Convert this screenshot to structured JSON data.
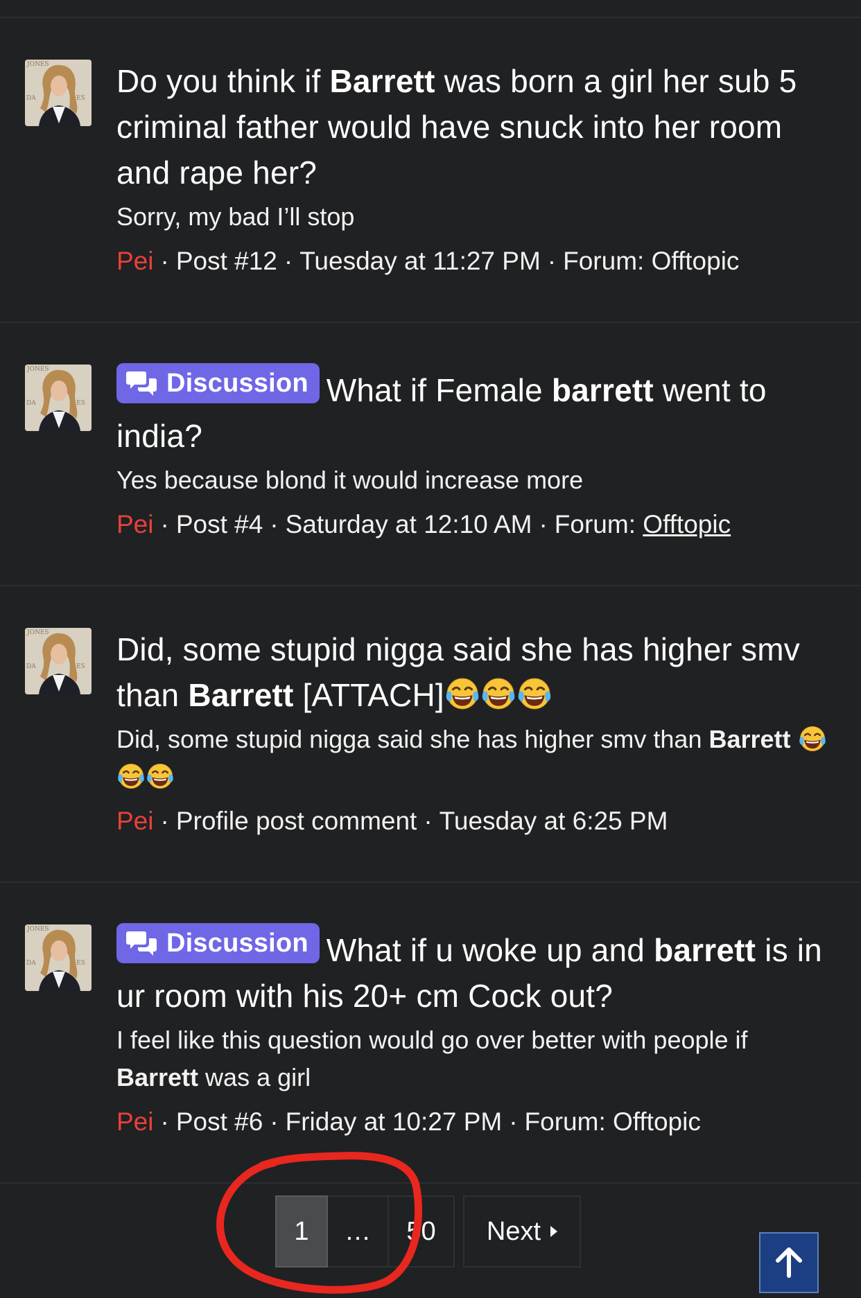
{
  "results": [
    {
      "title_parts": [
        {
          "text": "Do you think if ",
          "bold": false
        },
        {
          "text": "Barrett",
          "bold": true
        },
        {
          "text": " was born a girl her sub 5 criminal father would have snuck into her room and rape her?",
          "bold": false
        }
      ],
      "badge": null,
      "snippet_parts": [
        {
          "text": "Sorry, my bad I’ll stop",
          "bold": false
        }
      ],
      "meta": {
        "user": "Pei",
        "type": "Post #12",
        "time": "Tuesday at 11:27 PM",
        "forum_label": "Forum:",
        "forum": "Offtopic",
        "forum_link": false
      }
    },
    {
      "title_parts": [
        {
          "text": "What if Female ",
          "bold": false
        },
        {
          "text": "barrett",
          "bold": true
        },
        {
          "text": " went to india?",
          "bold": false
        }
      ],
      "badge": "Discussion",
      "snippet_parts": [
        {
          "text": "Yes because blond it would increase more",
          "bold": false
        }
      ],
      "meta": {
        "user": "Pei",
        "type": "Post #4",
        "time": "Saturday at 12:10 AM",
        "forum_label": "Forum:",
        "forum": "Offtopic",
        "forum_link": true
      }
    },
    {
      "title_parts": [
        {
          "text": "Did, some stupid nigga said she has higher smv than ",
          "bold": false
        },
        {
          "text": "Barrett",
          "bold": true
        },
        {
          "text": " [ATTACH]",
          "bold": false
        }
      ],
      "title_emoji_count": 3,
      "badge": null,
      "snippet_parts": [
        {
          "text": "Did, some stupid nigga said she has higher smv than ",
          "bold": false
        },
        {
          "text": "Barrett",
          "bold": true
        }
      ],
      "snippet_emoji_count": 3,
      "meta": {
        "user": "Pei",
        "type": "Profile post comment",
        "time": "Tuesday at 6:25 PM",
        "forum_label": null,
        "forum": null,
        "forum_link": false
      }
    },
    {
      "title_parts": [
        {
          "text": "What if u woke up and ",
          "bold": false
        },
        {
          "text": "barrett",
          "bold": true
        },
        {
          "text": " is in ur room with his 20+ cm Cock out?",
          "bold": false
        }
      ],
      "badge": "Discussion",
      "snippet_parts": [
        {
          "text": "I feel like this question would go over better with people if ",
          "bold": false
        },
        {
          "text": "Barrett",
          "bold": true
        },
        {
          "text": " was a girl",
          "bold": false
        }
      ],
      "meta": {
        "user": "Pei",
        "type": "Post #6",
        "time": "Friday at 10:27 PM",
        "forum_label": "Forum:",
        "forum": "Offtopic",
        "forum_link": false
      }
    }
  ],
  "pagination": {
    "current": "1",
    "ellipsis": "…",
    "last": "50",
    "next": "Next"
  },
  "icons": {
    "badge_icon": "chat-bubbles-icon",
    "emoji": "tears-of-joy-emoji",
    "scroll_top": "arrow-up-icon",
    "next": "caret-right-icon"
  },
  "colors": {
    "background": "#202123",
    "username": "#e8413a",
    "badge": "#6f67e6",
    "annotation_circle": "#e8271f",
    "scroll_top": "#1b3f82"
  }
}
